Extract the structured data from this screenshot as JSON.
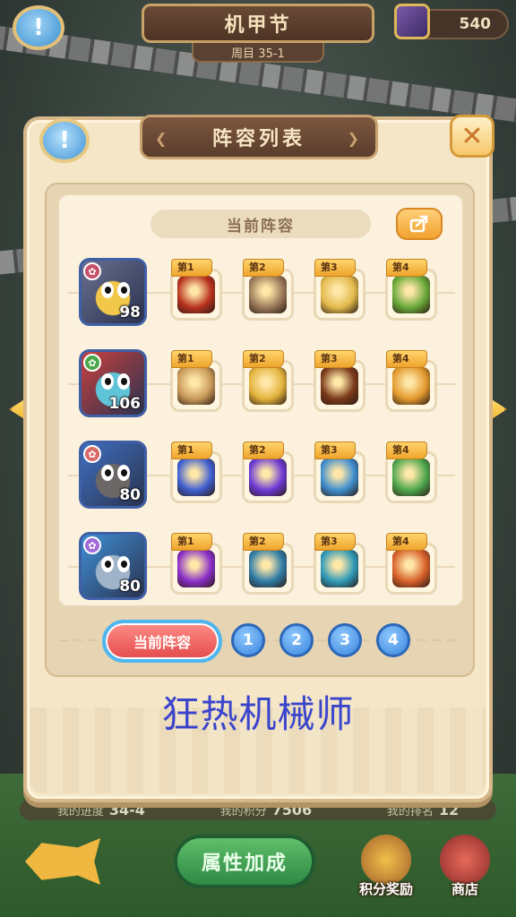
{
  "hud": {
    "info_icon": "!",
    "event_title": "机甲节",
    "stage_label": "周目 35-1",
    "coins": "540"
  },
  "dialog": {
    "info_icon": "!",
    "title": "阵容列表",
    "close_icon": "✕",
    "section_title": "当前阵容",
    "share_icon": "share-icon",
    "caption": "狂热机械师",
    "rows": [
      {
        "hero": {
          "level": "98",
          "color": "#6a6f8f",
          "skin": "#f2c84a",
          "element_color": "#c9506a"
        },
        "skills": [
          {
            "tag": "第1",
            "color": "#b8321e"
          },
          {
            "tag": "第2",
            "color": "#9b7a5a"
          },
          {
            "tag": "第3",
            "color": "#e2b94c"
          },
          {
            "tag": "第4",
            "color": "#6aa93a"
          }
        ]
      },
      {
        "hero": {
          "level": "106",
          "color": "#c8403e",
          "skin": "#5fc4d8",
          "element_color": "#4aa84a"
        },
        "skills": [
          {
            "tag": "第1",
            "color": "#c99a5a"
          },
          {
            "tag": "第2",
            "color": "#e3b23c"
          },
          {
            "tag": "第3",
            "color": "#7a3a1a"
          },
          {
            "tag": "第4",
            "color": "#e39a2e"
          }
        ]
      },
      {
        "hero": {
          "level": "80",
          "color": "#3f6fbf",
          "skin": "#6b6766",
          "element_color": "#d86a6a"
        },
        "skills": [
          {
            "tag": "第1",
            "color": "#3f5fd0"
          },
          {
            "tag": "第2",
            "color": "#6c3ad6"
          },
          {
            "tag": "第3",
            "color": "#3e8ecf"
          },
          {
            "tag": "第4",
            "color": "#4ea84e"
          }
        ]
      },
      {
        "hero": {
          "level": "80",
          "color": "#3f8fd6",
          "skin": "#9fb4c8",
          "element_color": "#a06ad8"
        },
        "skills": [
          {
            "tag": "第1",
            "color": "#8a2ec8"
          },
          {
            "tag": "第2",
            "color": "#2e7ca6"
          },
          {
            "tag": "第3",
            "color": "#2e9ab8"
          },
          {
            "tag": "第4",
            "color": "#d8602a"
          }
        ]
      }
    ],
    "pager": {
      "active_label": "当前阵容",
      "pages": [
        "1",
        "2",
        "3",
        "4"
      ]
    }
  },
  "footer": {
    "progress_label": "我的进度",
    "progress_value": "34-4",
    "score_label": "我的积分",
    "score_value": "7506",
    "rank_label": "我的排名",
    "rank_value": "12",
    "attribute_button": "属性加成",
    "reward_label": "积分奖励",
    "shop_label": "商店"
  }
}
